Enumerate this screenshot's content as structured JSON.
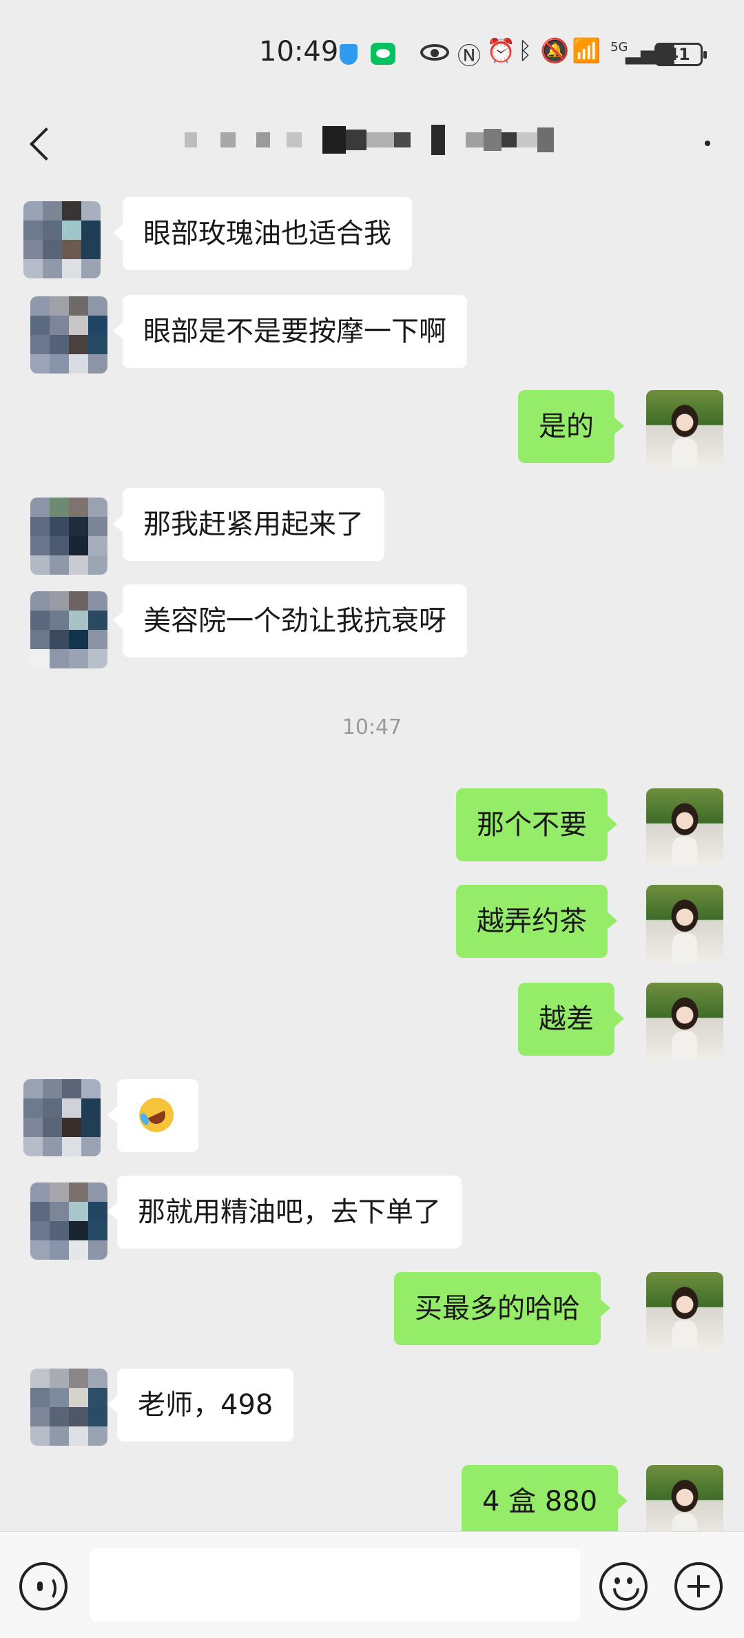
{
  "status_bar": {
    "time": "10:49",
    "network": "5G",
    "battery": "41",
    "icons": [
      "shield-icon",
      "wechat-icon",
      "eye-icon",
      "nfc-icon",
      "alarm-icon",
      "bluetooth-icon",
      "mute-icon",
      "wifi-icon",
      "signal-icon",
      "battery-icon"
    ]
  },
  "header": {
    "back_icon": "chevron-left-icon",
    "title_redacted": true,
    "more_icon": "more-icon"
  },
  "messages": [
    {
      "side": "left",
      "text": "眼部玫瑰油也适合我"
    },
    {
      "side": "left",
      "text": "眼部是不是要按摩一下啊"
    },
    {
      "side": "right",
      "text": "是的"
    },
    {
      "side": "left",
      "text": "那我赶紧用起来了"
    },
    {
      "side": "left",
      "text": "美容院一个劲让我抗衰呀"
    },
    {
      "type": "timestamp",
      "text": "10:47"
    },
    {
      "side": "right",
      "text": "那个不要"
    },
    {
      "side": "right",
      "text": "越弄约茶"
    },
    {
      "side": "right",
      "text": "越差"
    },
    {
      "side": "left",
      "emoji": "rolling-on-floor-laughing-emoji"
    },
    {
      "side": "left",
      "text": "那就用精油吧，去下单了"
    },
    {
      "side": "right",
      "text": "买最多的哈哈"
    },
    {
      "side": "left",
      "text": "老师，498"
    },
    {
      "side": "right",
      "text": "4 盒 880"
    }
  ],
  "input_bar": {
    "voice_icon": "voice-icon",
    "placeholder": "",
    "emoji_icon": "emoji-icon",
    "plus_icon": "plus-icon"
  },
  "colors": {
    "background": "#ededed",
    "sent_bubble": "#95ec69",
    "received_bubble": "#ffffff",
    "timestamp_text": "#9a9a9a"
  }
}
